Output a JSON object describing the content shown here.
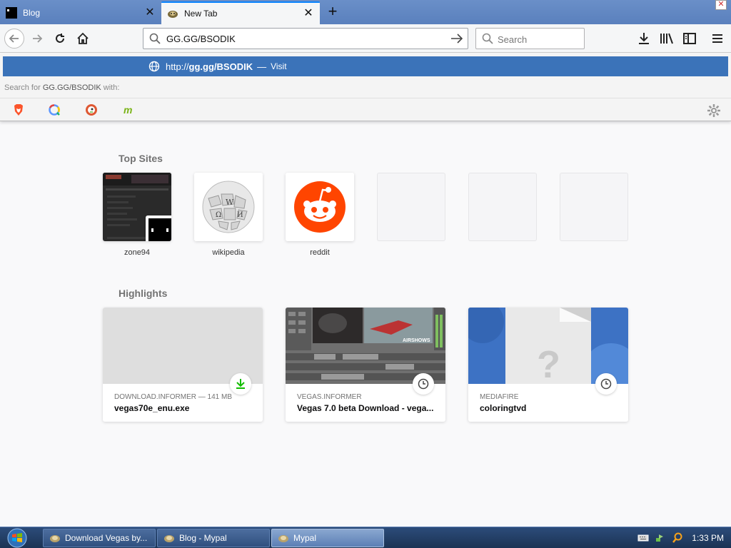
{
  "tabs": [
    {
      "title": "Blog"
    },
    {
      "title": "New Tab"
    }
  ],
  "urlbar": {
    "value": "GG.GG/BSODIK"
  },
  "searchbar": {
    "placeholder": "Search"
  },
  "popup": {
    "suggestion_scheme": "http://",
    "suggestion_host": "gg.gg/BSODIK",
    "suggestion_sep": "—",
    "suggestion_action": "Visit",
    "search_for_prefix": "Search for",
    "search_for_term": "GG.GG/BSODIK",
    "search_for_suffix": "with:"
  },
  "top_sites": {
    "title": "Top Sites",
    "items": [
      {
        "label": "zone94"
      },
      {
        "label": "wikipedia"
      },
      {
        "label": "reddit"
      }
    ]
  },
  "highlights": {
    "title": "Highlights",
    "items": [
      {
        "source": "DOWNLOAD.INFORMER — 141 MB",
        "title": "vegas70e_enu.exe",
        "badge": "download-icon"
      },
      {
        "source": "VEGAS.INFORMER",
        "title": "Vegas 7.0 beta Download - vega...",
        "badge": "clock-icon"
      },
      {
        "source": "MEDIAFIRE",
        "title": "coloringtvd",
        "badge": "clock-icon"
      }
    ]
  },
  "taskbar": {
    "items": [
      {
        "label": "Download Vegas by..."
      },
      {
        "label": "Blog - Mypal"
      },
      {
        "label": "Mypal"
      }
    ],
    "clock": "1:33 PM"
  },
  "colors": {
    "accent": "#3b73b9",
    "reddit": "#ff4500",
    "download_green": "#12bc00"
  }
}
